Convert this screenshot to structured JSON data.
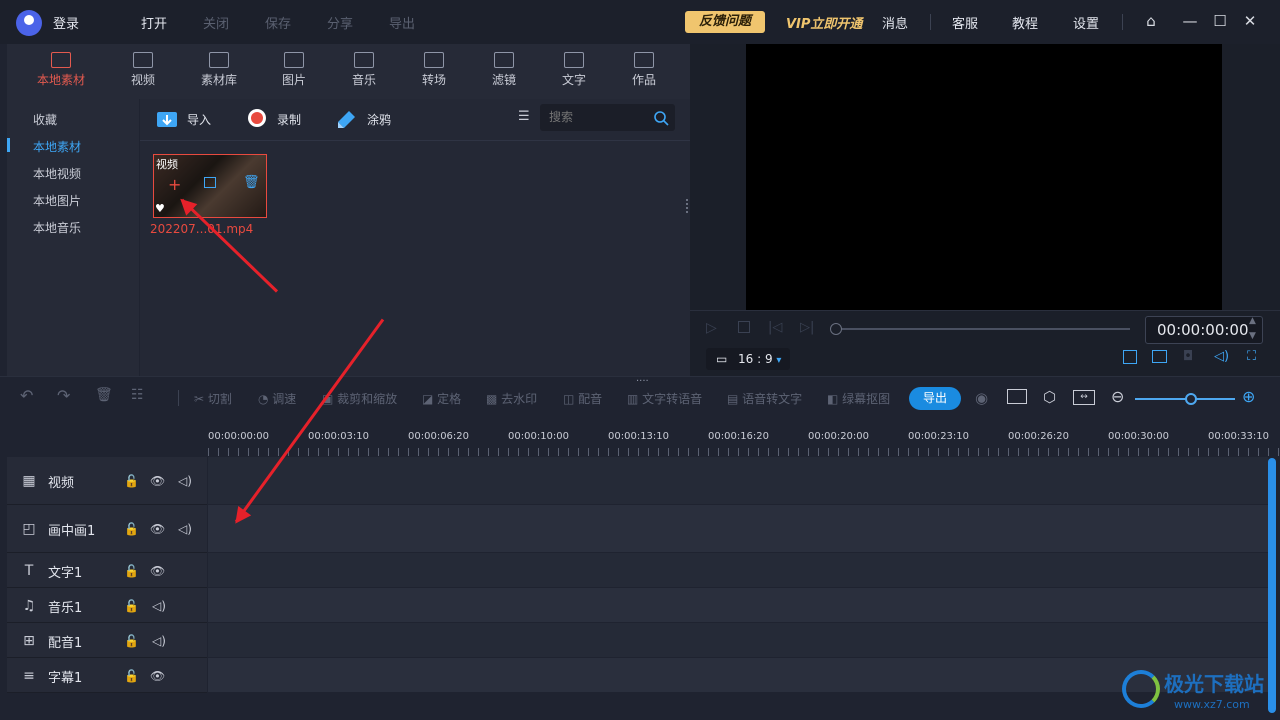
{
  "titlebar": {
    "login": "登录",
    "menu": [
      "打开",
      "关闭",
      "保存",
      "分享",
      "导出"
    ],
    "feedback": "反馈问题",
    "vip": "VIP立即开通",
    "links": [
      "消息",
      "客服",
      "教程",
      "设置"
    ]
  },
  "categories": [
    {
      "label": "本地素材",
      "icon": "local-media-icon",
      "active": true
    },
    {
      "label": "视频",
      "icon": "film-icon"
    },
    {
      "label": "素材库",
      "icon": "library-icon"
    },
    {
      "label": "图片",
      "icon": "image-icon"
    },
    {
      "label": "音乐",
      "icon": "music-icon"
    },
    {
      "label": "转场",
      "icon": "transition-icon"
    },
    {
      "label": "滤镜",
      "icon": "filter-icon"
    },
    {
      "label": "文字",
      "icon": "text-icon"
    },
    {
      "label": "作品",
      "icon": "folder-icon"
    }
  ],
  "sidebar": {
    "items": [
      "收藏",
      "本地素材",
      "本地视频",
      "本地图片",
      "本地音乐"
    ],
    "active_index": 1
  },
  "media_toolbar": {
    "import": "导入",
    "record": "录制",
    "doodle": "涂鸦",
    "search_placeholder": "搜索"
  },
  "media_item": {
    "tag": "视频",
    "name": "202207...01.mp4"
  },
  "preview": {
    "timecode": "00:00:00:00",
    "ratio": "16 : 9"
  },
  "edit_toolbar": {
    "tools": [
      "切割",
      "调速",
      "裁剪和缩放",
      "定格",
      "去水印",
      "配音",
      "文字转语音",
      "语音转文字",
      "绿幕抠图"
    ],
    "export": "导出"
  },
  "ruler": {
    "ticks": [
      "00:00:00:00",
      "00:00:03:10",
      "00:00:06:20",
      "00:00:10:00",
      "00:00:13:10",
      "00:00:16:20",
      "00:00:20:00",
      "00:00:23:10",
      "00:00:26:20",
      "00:00:30:00",
      "00:00:33:10"
    ]
  },
  "tracks": [
    {
      "name": "视频",
      "icon": "film-icon"
    },
    {
      "name": "画中画1",
      "icon": "pip-icon"
    },
    {
      "name": "文字1",
      "icon": "text-icon"
    },
    {
      "name": "音乐1",
      "icon": "music-icon"
    },
    {
      "name": "配音1",
      "icon": "microphone-icon"
    },
    {
      "name": "字幕1",
      "icon": "subtitle-icon"
    }
  ],
  "watermark": {
    "title": "极光下载站",
    "url": "www.xz7.com"
  },
  "colors": {
    "accent_red": "#e45a4f",
    "accent_blue": "#3ea6f5",
    "feedback_gold": "#f0c56e",
    "export_blue": "#1a8be0"
  }
}
